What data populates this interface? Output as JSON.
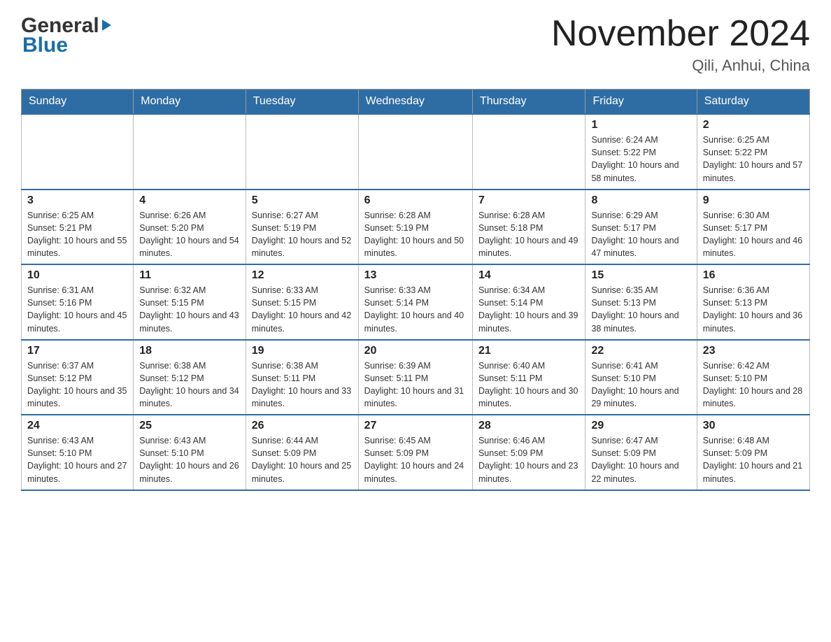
{
  "header": {
    "logo_general": "General",
    "logo_blue": "Blue",
    "month_year": "November 2024",
    "location": "Qili, Anhui, China"
  },
  "weekdays": [
    "Sunday",
    "Monday",
    "Tuesday",
    "Wednesday",
    "Thursday",
    "Friday",
    "Saturday"
  ],
  "weeks": [
    [
      {
        "day": "",
        "sunrise": "",
        "sunset": "",
        "daylight": ""
      },
      {
        "day": "",
        "sunrise": "",
        "sunset": "",
        "daylight": ""
      },
      {
        "day": "",
        "sunrise": "",
        "sunset": "",
        "daylight": ""
      },
      {
        "day": "",
        "sunrise": "",
        "sunset": "",
        "daylight": ""
      },
      {
        "day": "",
        "sunrise": "",
        "sunset": "",
        "daylight": ""
      },
      {
        "day": "1",
        "sunrise": "Sunrise: 6:24 AM",
        "sunset": "Sunset: 5:22 PM",
        "daylight": "Daylight: 10 hours and 58 minutes."
      },
      {
        "day": "2",
        "sunrise": "Sunrise: 6:25 AM",
        "sunset": "Sunset: 5:22 PM",
        "daylight": "Daylight: 10 hours and 57 minutes."
      }
    ],
    [
      {
        "day": "3",
        "sunrise": "Sunrise: 6:25 AM",
        "sunset": "Sunset: 5:21 PM",
        "daylight": "Daylight: 10 hours and 55 minutes."
      },
      {
        "day": "4",
        "sunrise": "Sunrise: 6:26 AM",
        "sunset": "Sunset: 5:20 PM",
        "daylight": "Daylight: 10 hours and 54 minutes."
      },
      {
        "day": "5",
        "sunrise": "Sunrise: 6:27 AM",
        "sunset": "Sunset: 5:19 PM",
        "daylight": "Daylight: 10 hours and 52 minutes."
      },
      {
        "day": "6",
        "sunrise": "Sunrise: 6:28 AM",
        "sunset": "Sunset: 5:19 PM",
        "daylight": "Daylight: 10 hours and 50 minutes."
      },
      {
        "day": "7",
        "sunrise": "Sunrise: 6:28 AM",
        "sunset": "Sunset: 5:18 PM",
        "daylight": "Daylight: 10 hours and 49 minutes."
      },
      {
        "day": "8",
        "sunrise": "Sunrise: 6:29 AM",
        "sunset": "Sunset: 5:17 PM",
        "daylight": "Daylight: 10 hours and 47 minutes."
      },
      {
        "day": "9",
        "sunrise": "Sunrise: 6:30 AM",
        "sunset": "Sunset: 5:17 PM",
        "daylight": "Daylight: 10 hours and 46 minutes."
      }
    ],
    [
      {
        "day": "10",
        "sunrise": "Sunrise: 6:31 AM",
        "sunset": "Sunset: 5:16 PM",
        "daylight": "Daylight: 10 hours and 45 minutes."
      },
      {
        "day": "11",
        "sunrise": "Sunrise: 6:32 AM",
        "sunset": "Sunset: 5:15 PM",
        "daylight": "Daylight: 10 hours and 43 minutes."
      },
      {
        "day": "12",
        "sunrise": "Sunrise: 6:33 AM",
        "sunset": "Sunset: 5:15 PM",
        "daylight": "Daylight: 10 hours and 42 minutes."
      },
      {
        "day": "13",
        "sunrise": "Sunrise: 6:33 AM",
        "sunset": "Sunset: 5:14 PM",
        "daylight": "Daylight: 10 hours and 40 minutes."
      },
      {
        "day": "14",
        "sunrise": "Sunrise: 6:34 AM",
        "sunset": "Sunset: 5:14 PM",
        "daylight": "Daylight: 10 hours and 39 minutes."
      },
      {
        "day": "15",
        "sunrise": "Sunrise: 6:35 AM",
        "sunset": "Sunset: 5:13 PM",
        "daylight": "Daylight: 10 hours and 38 minutes."
      },
      {
        "day": "16",
        "sunrise": "Sunrise: 6:36 AM",
        "sunset": "Sunset: 5:13 PM",
        "daylight": "Daylight: 10 hours and 36 minutes."
      }
    ],
    [
      {
        "day": "17",
        "sunrise": "Sunrise: 6:37 AM",
        "sunset": "Sunset: 5:12 PM",
        "daylight": "Daylight: 10 hours and 35 minutes."
      },
      {
        "day": "18",
        "sunrise": "Sunrise: 6:38 AM",
        "sunset": "Sunset: 5:12 PM",
        "daylight": "Daylight: 10 hours and 34 minutes."
      },
      {
        "day": "19",
        "sunrise": "Sunrise: 6:38 AM",
        "sunset": "Sunset: 5:11 PM",
        "daylight": "Daylight: 10 hours and 33 minutes."
      },
      {
        "day": "20",
        "sunrise": "Sunrise: 6:39 AM",
        "sunset": "Sunset: 5:11 PM",
        "daylight": "Daylight: 10 hours and 31 minutes."
      },
      {
        "day": "21",
        "sunrise": "Sunrise: 6:40 AM",
        "sunset": "Sunset: 5:11 PM",
        "daylight": "Daylight: 10 hours and 30 minutes."
      },
      {
        "day": "22",
        "sunrise": "Sunrise: 6:41 AM",
        "sunset": "Sunset: 5:10 PM",
        "daylight": "Daylight: 10 hours and 29 minutes."
      },
      {
        "day": "23",
        "sunrise": "Sunrise: 6:42 AM",
        "sunset": "Sunset: 5:10 PM",
        "daylight": "Daylight: 10 hours and 28 minutes."
      }
    ],
    [
      {
        "day": "24",
        "sunrise": "Sunrise: 6:43 AM",
        "sunset": "Sunset: 5:10 PM",
        "daylight": "Daylight: 10 hours and 27 minutes."
      },
      {
        "day": "25",
        "sunrise": "Sunrise: 6:43 AM",
        "sunset": "Sunset: 5:10 PM",
        "daylight": "Daylight: 10 hours and 26 minutes."
      },
      {
        "day": "26",
        "sunrise": "Sunrise: 6:44 AM",
        "sunset": "Sunset: 5:09 PM",
        "daylight": "Daylight: 10 hours and 25 minutes."
      },
      {
        "day": "27",
        "sunrise": "Sunrise: 6:45 AM",
        "sunset": "Sunset: 5:09 PM",
        "daylight": "Daylight: 10 hours and 24 minutes."
      },
      {
        "day": "28",
        "sunrise": "Sunrise: 6:46 AM",
        "sunset": "Sunset: 5:09 PM",
        "daylight": "Daylight: 10 hours and 23 minutes."
      },
      {
        "day": "29",
        "sunrise": "Sunrise: 6:47 AM",
        "sunset": "Sunset: 5:09 PM",
        "daylight": "Daylight: 10 hours and 22 minutes."
      },
      {
        "day": "30",
        "sunrise": "Sunrise: 6:48 AM",
        "sunset": "Sunset: 5:09 PM",
        "daylight": "Daylight: 10 hours and 21 minutes."
      }
    ]
  ]
}
